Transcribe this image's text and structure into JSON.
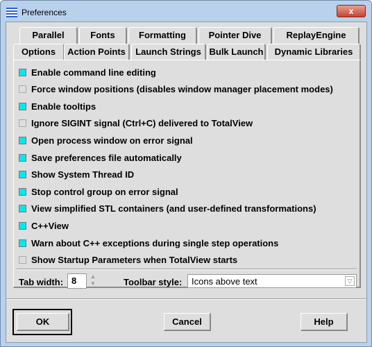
{
  "window": {
    "title": "Preferences",
    "close_glyph": "x"
  },
  "tabs_row1": [
    "Parallel",
    "Fonts",
    "Formatting",
    "Pointer Dive",
    "ReplayEngine"
  ],
  "tabs_row2": [
    "Options",
    "Action Points",
    "Launch Strings",
    "Bulk Launch",
    "Dynamic Libraries"
  ],
  "active_tab": "Options",
  "options": [
    {
      "label": "Enable command line editing",
      "checked": true
    },
    {
      "label": "Force window positions (disables window manager placement modes)",
      "checked": false
    },
    {
      "label": "Enable tooltips",
      "checked": true
    },
    {
      "label": "Ignore SIGINT signal (Ctrl+C) delivered to TotalView",
      "checked": false
    },
    {
      "label": "Open process window on error signal",
      "checked": true
    },
    {
      "label": "Save preferences file automatically",
      "checked": true
    },
    {
      "label": "Show System Thread ID",
      "checked": true
    },
    {
      "label": "Stop control group on error signal",
      "checked": true
    },
    {
      "label": "View simplified STL containers (and user-defined transformations)",
      "checked": true
    },
    {
      "label": "C++View",
      "checked": true
    },
    {
      "label": "Warn about C++ exceptions during single step operations",
      "checked": true
    },
    {
      "label": "Show Startup Parameters when TotalView starts",
      "checked": false
    }
  ],
  "tab_width": {
    "label": "Tab width:",
    "value": "8"
  },
  "toolbar_style": {
    "label": "Toolbar style:",
    "value": "Icons above text"
  },
  "buttons": {
    "ok": "OK",
    "cancel": "Cancel",
    "help": "Help"
  },
  "colors": {
    "checked": "#00e8f0",
    "frame": "#b9d1ea"
  }
}
